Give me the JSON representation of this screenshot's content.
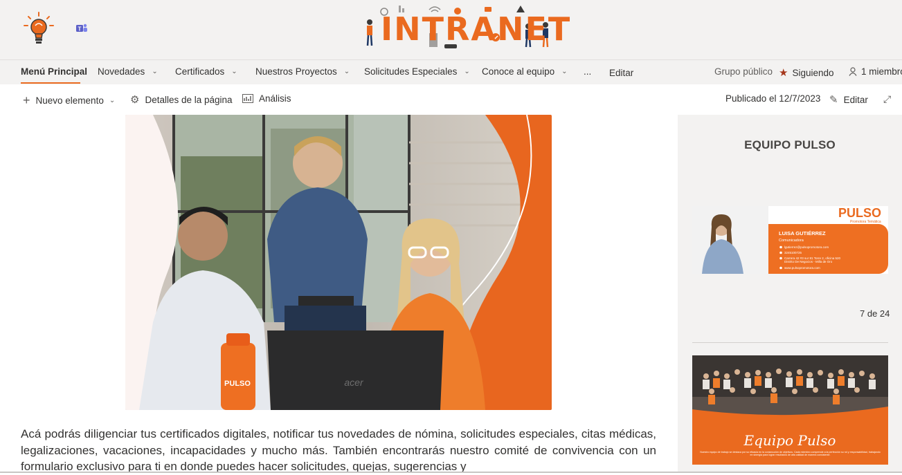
{
  "header": {
    "logo_text": "INTRANET"
  },
  "nav": {
    "items": [
      {
        "label": "Menú Principal"
      },
      {
        "label": "Novedades"
      },
      {
        "label": "Certificados"
      },
      {
        "label": "Nuestros Proyectos"
      },
      {
        "label": "Solicitudes Especiales"
      },
      {
        "label": "Conoce al equipo"
      },
      {
        "label": "..."
      },
      {
        "label": "Editar"
      }
    ],
    "group_label": "Grupo público",
    "following_label": "Siguiendo",
    "members_label": "1 miembro"
  },
  "commandbar": {
    "new_label": "Nuevo elemento",
    "details_label": "Detalles de la página",
    "analytics_label": "Análisis",
    "published_label": "Publicado el 12/7/2023",
    "edit_label": "Editar"
  },
  "main": {
    "hero": {
      "bottle_text": "PULSO",
      "laptop_text": "acer"
    },
    "paragraph": "Acá podrás diligenciar tus certificados digitales, notificar tus novedades de nómina, solicitudes especiales, citas médicas, legalizaciones, vacaciones, incapacidades y mucho más. También encontrarás nuestro comité de convivencia con un formulario exclusivo para ti en donde puedes hacer solicitudes, quejas, sugerencias y"
  },
  "sidebar": {
    "title": "EQUIPO PULSO",
    "card1": {
      "brand": "PULSO",
      "brand_sub": "Promotora Temática",
      "name": "LUISA GUTIÉRREZ",
      "role": "Comunicadora",
      "email": "lgutierrez@pulsopromotora.com",
      "phone": "3245100725",
      "address1": "Carrera 42 #3 sur 81 Torre 2, oficina 520",
      "address2": "Distrito De Negocios - Milla de Oro",
      "web": "www.pulsopromotora.com"
    },
    "counter": "7 de 24",
    "card2": {
      "title": "Equipo Pulso",
      "caption": "Nuestro equipo de trabajo se destaca por su eficacia en la consecución de objetivos. Cada miembro comprende a la perfección su rol y responsabilidad, trabajando en sinergia para lograr resultados de alta calidad de manera consistente."
    }
  },
  "colors": {
    "accent": "#ea6a1f",
    "nav_bg": "#f3f2f1",
    "follow_star": "#a5371b"
  }
}
